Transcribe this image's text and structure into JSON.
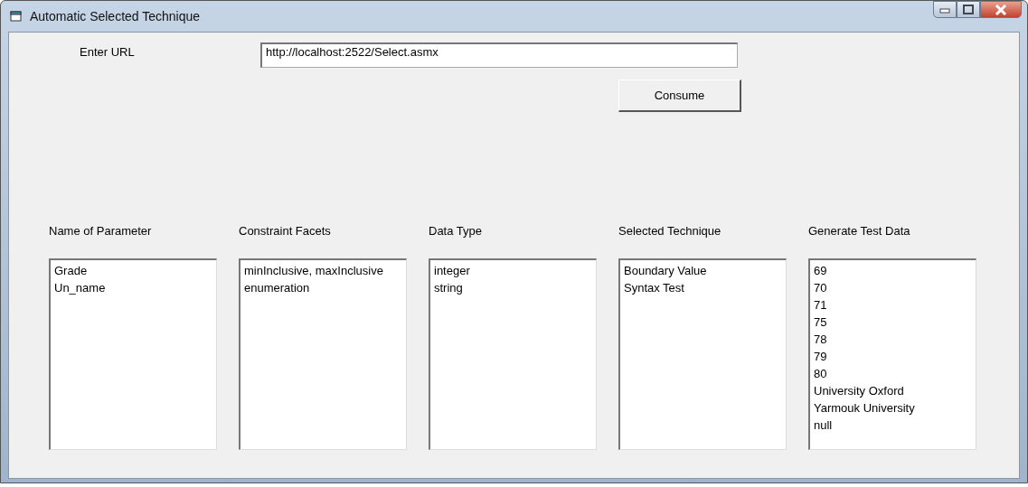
{
  "window": {
    "title": "Automatic Selected Technique"
  },
  "url": {
    "label": "Enter URL",
    "value": "http://localhost:2522/Select.asmx"
  },
  "consume_button": "Consume",
  "columns": [
    {
      "heading": "Name of Parameter",
      "items": [
        "Grade",
        "Un_name"
      ]
    },
    {
      "heading": "Constraint Facets",
      "items": [
        "minInclusive, maxInclusive",
        "enumeration"
      ]
    },
    {
      "heading": "Data Type",
      "items": [
        "integer",
        "string"
      ]
    },
    {
      "heading": "Selected Technique",
      "items": [
        "Boundary Value",
        "Syntax Test"
      ]
    },
    {
      "heading": "Generate Test Data",
      "items": [
        "69",
        "70",
        "71",
        "75",
        "78",
        "79",
        "80",
        "University Oxford",
        "Yarmouk University",
        "null"
      ]
    }
  ]
}
